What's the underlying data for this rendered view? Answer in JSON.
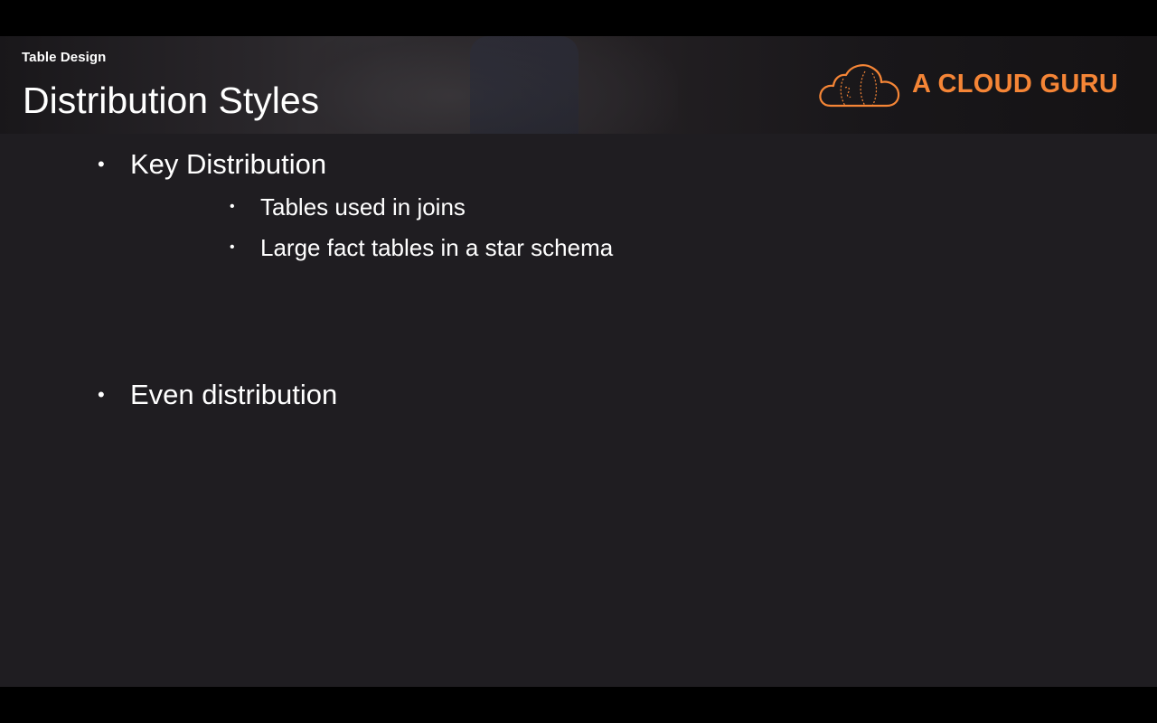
{
  "header": {
    "section_label": "Table Design",
    "title": "Distribution Styles",
    "logo": {
      "text": "A CLOUD GURU",
      "icon": "cloud-logo-icon",
      "color": "#f58536"
    }
  },
  "content": {
    "bullets": [
      {
        "text": "Key Distribution",
        "sub": [
          {
            "text": "Tables used in joins"
          },
          {
            "text": "Large fact tables in a star schema"
          }
        ]
      },
      {
        "text": "Even distribution",
        "sub": []
      }
    ],
    "bullet_glyph": "•"
  },
  "colors": {
    "slide_background": "#1f1d21",
    "text": "#ffffff",
    "accent": "#f58536"
  }
}
